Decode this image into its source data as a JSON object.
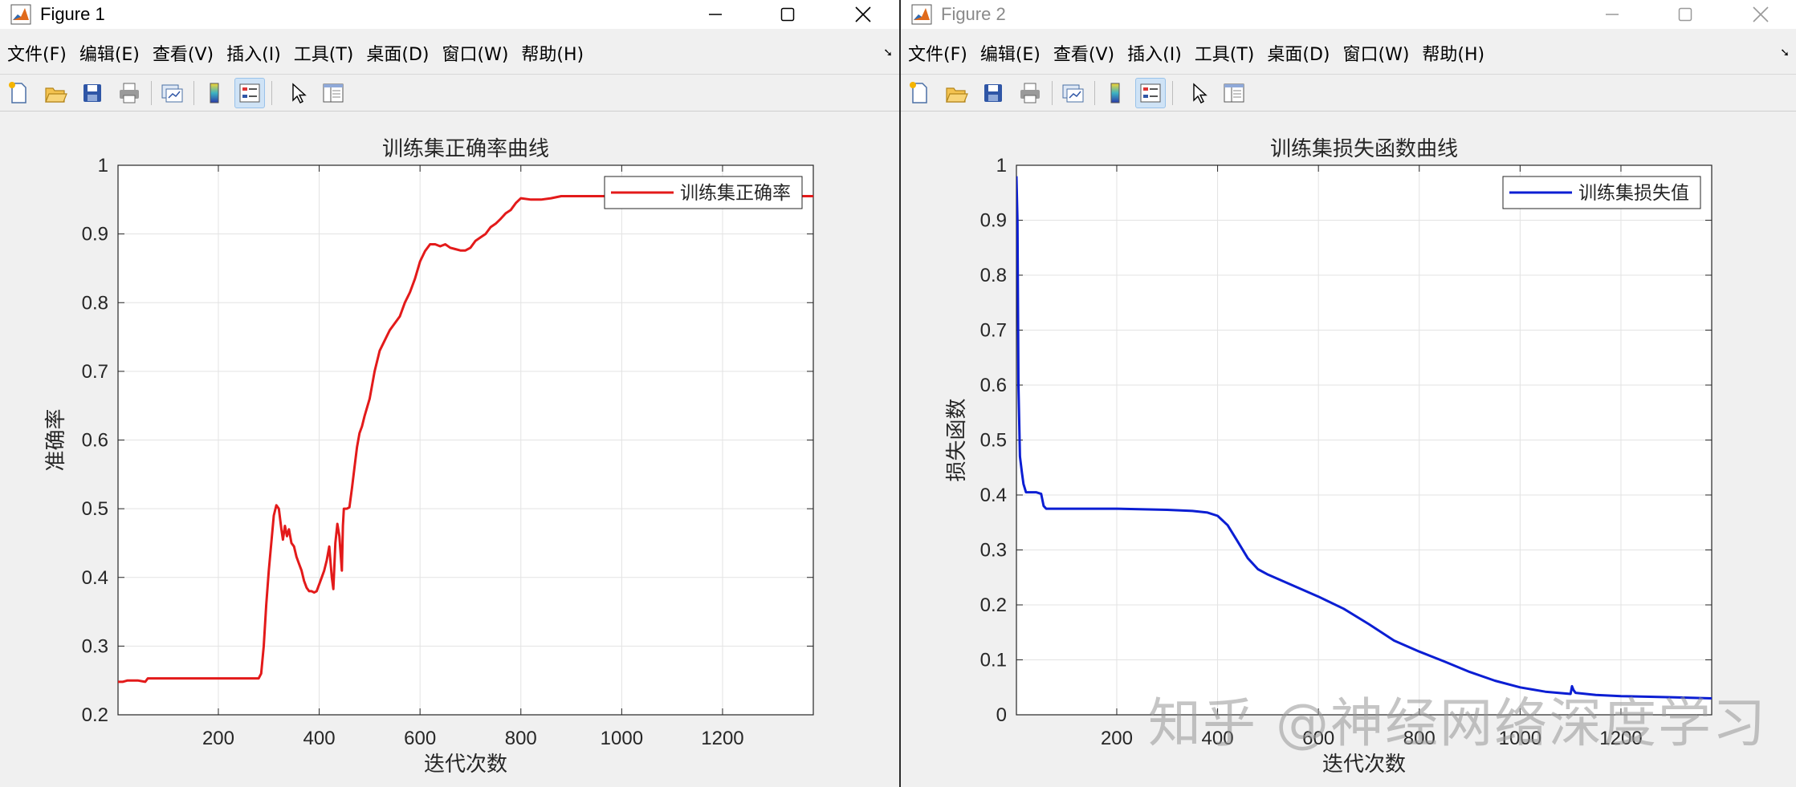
{
  "windows": [
    {
      "title": "Figure 1",
      "menu": [
        "文件(F)",
        "编辑(E)",
        "查看(V)",
        "插入(I)",
        "工具(T)",
        "桌面(D)",
        "窗口(W)",
        "帮助(H)"
      ]
    },
    {
      "title": "Figure 2",
      "menu": [
        "文件(F)",
        "编辑(E)",
        "查看(V)",
        "插入(I)",
        "工具(T)",
        "桌面(D)",
        "窗口(W)",
        "帮助(H)"
      ]
    }
  ],
  "toolbar_icons": [
    "new-figure-icon",
    "open-file-icon",
    "save-icon",
    "print-icon",
    "link-plot-icon",
    "colorbar-icon",
    "legend-icon",
    "edit-plot-icon",
    "property-editor-icon"
  ],
  "watermark": "知乎 @神经网络深度学习",
  "chart_data": [
    {
      "type": "line",
      "title": "训练集正确率曲线",
      "xlabel": "迭代次数",
      "ylabel": "准确率",
      "xlim": [
        1,
        1380
      ],
      "ylim": [
        0.2,
        1
      ],
      "xticks": [
        200,
        400,
        600,
        800,
        1000,
        1200
      ],
      "yticks": [
        0.2,
        0.3,
        0.4,
        0.5,
        0.6,
        0.7,
        0.8,
        0.9,
        1
      ],
      "grid": true,
      "legend": "top-right",
      "color": "#e31a1a",
      "series": [
        {
          "name": "训练集正确率",
          "x": [
            1,
            10,
            20,
            40,
            55,
            60,
            100,
            150,
            200,
            250,
            280,
            285,
            290,
            295,
            300,
            305,
            310,
            315,
            320,
            325,
            328,
            332,
            336,
            340,
            345,
            350,
            355,
            360,
            365,
            370,
            375,
            380,
            385,
            390,
            395,
            400,
            405,
            410,
            415,
            420,
            425,
            428,
            432,
            436,
            440,
            445,
            447,
            449,
            452,
            455,
            460,
            465,
            470,
            475,
            480,
            485,
            490,
            500,
            510,
            520,
            530,
            540,
            550,
            560,
            570,
            580,
            590,
            600,
            610,
            620,
            630,
            640,
            650,
            660,
            670,
            680,
            690,
            700,
            710,
            720,
            730,
            740,
            750,
            760,
            770,
            780,
            790,
            800,
            820,
            840,
            860,
            880,
            900,
            950,
            1000,
            1100,
            1200,
            1300,
            1380
          ],
          "y": [
            0.248,
            0.248,
            0.25,
            0.25,
            0.248,
            0.253,
            0.253,
            0.253,
            0.253,
            0.253,
            0.253,
            0.26,
            0.3,
            0.36,
            0.41,
            0.45,
            0.49,
            0.505,
            0.5,
            0.47,
            0.455,
            0.475,
            0.46,
            0.47,
            0.45,
            0.445,
            0.43,
            0.42,
            0.41,
            0.395,
            0.385,
            0.38,
            0.38,
            0.378,
            0.38,
            0.39,
            0.4,
            0.41,
            0.425,
            0.445,
            0.4,
            0.383,
            0.45,
            0.478,
            0.46,
            0.41,
            0.475,
            0.5,
            0.5,
            0.5,
            0.502,
            0.53,
            0.56,
            0.59,
            0.61,
            0.62,
            0.635,
            0.66,
            0.7,
            0.73,
            0.745,
            0.76,
            0.77,
            0.78,
            0.8,
            0.815,
            0.835,
            0.86,
            0.875,
            0.885,
            0.885,
            0.882,
            0.885,
            0.88,
            0.878,
            0.876,
            0.876,
            0.88,
            0.89,
            0.895,
            0.9,
            0.91,
            0.915,
            0.922,
            0.93,
            0.935,
            0.945,
            0.952,
            0.95,
            0.95,
            0.952,
            0.955,
            0.955,
            0.955,
            0.955,
            0.955,
            0.955,
            0.955,
            0.955
          ]
        }
      ]
    },
    {
      "type": "line",
      "title": "训练集损失函数曲线",
      "xlabel": "迭代次数",
      "ylabel": "损失函数",
      "xlim": [
        1,
        1380
      ],
      "ylim": [
        0,
        1
      ],
      "xticks": [
        200,
        400,
        600,
        800,
        1000,
        1200
      ],
      "yticks": [
        0,
        0.1,
        0.2,
        0.3,
        0.4,
        0.5,
        0.6,
        0.7,
        0.8,
        0.9,
        1
      ],
      "grid": true,
      "legend": "top-right",
      "color": "#0b1ed3",
      "series": [
        {
          "name": "训练集损失值",
          "x": [
            1,
            3,
            5,
            8,
            12,
            15,
            20,
            30,
            40,
            50,
            55,
            60,
            80,
            100,
            200,
            300,
            350,
            380,
            400,
            420,
            440,
            460,
            480,
            500,
            550,
            600,
            650,
            700,
            750,
            800,
            850,
            900,
            950,
            1000,
            1050,
            1100,
            1103,
            1106,
            1110,
            1150,
            1200,
            1300,
            1380
          ],
          "y": [
            0.98,
            0.9,
            0.6,
            0.47,
            0.44,
            0.42,
            0.405,
            0.405,
            0.405,
            0.402,
            0.38,
            0.375,
            0.375,
            0.375,
            0.375,
            0.373,
            0.371,
            0.368,
            0.362,
            0.345,
            0.315,
            0.285,
            0.265,
            0.255,
            0.235,
            0.215,
            0.193,
            0.165,
            0.135,
            0.115,
            0.097,
            0.078,
            0.062,
            0.05,
            0.042,
            0.038,
            0.052,
            0.045,
            0.04,
            0.036,
            0.034,
            0.032,
            0.03
          ]
        }
      ]
    }
  ]
}
